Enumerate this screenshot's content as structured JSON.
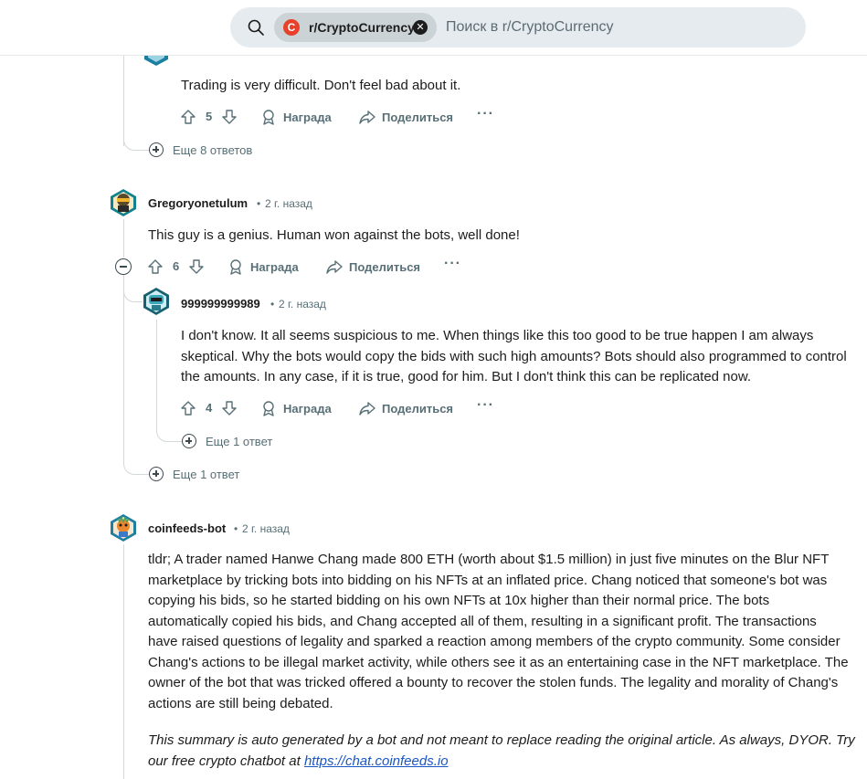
{
  "search": {
    "community": "r/CryptoCurrency",
    "placeholder": "Поиск в r/CryptoCurrency"
  },
  "comments": [
    {
      "text": "Trading is very difficult. Don't feel bad about it.",
      "votes": "5",
      "award": "Награда",
      "share": "Поделиться",
      "more_replies": "Еще 8 ответов"
    },
    {
      "author": "Gregoryonetulum",
      "time": "2 г. назад",
      "text": "This guy is a genius. Human won against the bots, well done!",
      "votes": "6",
      "award": "Награда",
      "share": "Поделиться",
      "more_replies": "Еще 1 ответ"
    },
    {
      "author": "999999999989",
      "time": "2 г. назад",
      "text": "I don't know. It all seems suspicious to me. When things like this too good to be true happen I am always skeptical. Why the bots would copy the bids with such high amounts? Bots should also programmed to control the amounts. In any case, if it is true, good for him. But I don't think this can be replicated now.",
      "votes": "4",
      "award": "Награда",
      "share": "Поделиться",
      "more_replies": "Еще 1 ответ"
    },
    {
      "author": "coinfeeds-bot",
      "time": "2 г. назад",
      "text": "tldr; A trader named Hanwe Chang made 800 ETH (worth about $1.5 million) in just five minutes on the Blur NFT marketplace by tricking bots into bidding on his NFTs at an inflated price. Chang noticed that someone's bot was copying his bids, so he started bidding on his own NFTs at 10x higher than their normal price. The bots automatically copied his bids, and Chang accepted all of them, resulting in a significant profit. The transactions have raised questions of legality and sparked a reaction among members of the crypto community. Some consider Chang's actions to be illegal market activity, while others see it as an entertaining case in the NFT marketplace. The owner of the bot that was tricked offered a bounty to recover the stolen funds. The legality and morality of Chang's actions are still being debated.",
      "disclaimer": "This summary is auto generated by a bot and not meant to replace reading the original article. As always, DYOR. Try our free crypto chatbot at ",
      "link_text": "https://chat.coinfeeds.io"
    }
  ],
  "separator": "•",
  "more_glyph": "···"
}
